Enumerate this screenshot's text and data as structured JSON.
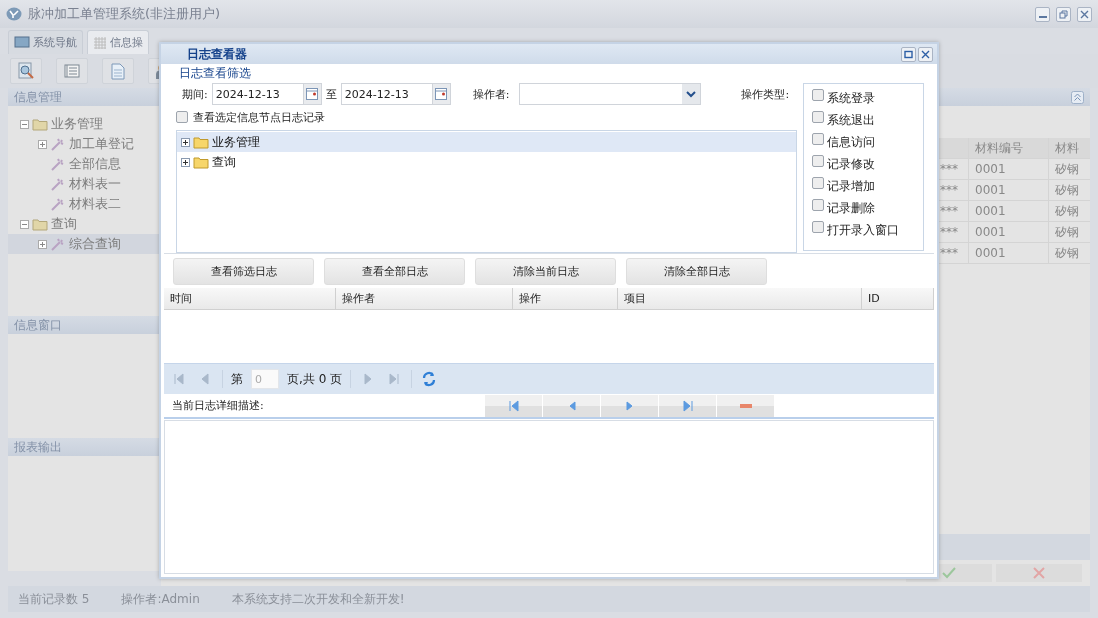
{
  "app": {
    "title": "脉冲加工单管理系统(非注册用户)"
  },
  "tabs": [
    {
      "label": "系统导航",
      "selected": false
    },
    {
      "label": "信息操",
      "selected": true
    }
  ],
  "sidebar": {
    "sections": [
      {
        "title": "信息管理",
        "tree": [
          {
            "label": "业务管理",
            "kind": "folder",
            "expanded": true,
            "selected": false,
            "children": [
              {
                "label": "加工单登记",
                "kind": "tool",
                "expanded": false,
                "selected": false
              },
              {
                "label": "全部信息",
                "kind": "tool",
                "selected": false
              },
              {
                "label": "材料表一",
                "kind": "tool",
                "selected": false
              },
              {
                "label": "材料表二",
                "kind": "tool",
                "selected": false
              }
            ]
          },
          {
            "label": "查询",
            "kind": "folder",
            "expanded": true,
            "selected": false,
            "children": [
              {
                "label": "综合查询",
                "kind": "tool",
                "expanded": false,
                "selected": true
              }
            ]
          }
        ]
      },
      {
        "title": "信息窗口"
      },
      {
        "title": "报表输出"
      }
    ]
  },
  "grid": {
    "columns": [
      "",
      "材料编号",
      "材料"
    ],
    "rows": [
      [
        "***",
        "0001",
        "矽钢"
      ],
      [
        "***",
        "0001",
        "矽钢"
      ],
      [
        "***",
        "0001",
        "矽钢"
      ],
      [
        "***",
        "0001",
        "矽钢"
      ],
      [
        "***",
        "0001",
        "矽钢"
      ]
    ]
  },
  "dialog": {
    "title": "日志查看器",
    "filter": {
      "legend": "日志查看筛选",
      "period_label": "期间:",
      "from": "2024-12-13",
      "to_label": "至",
      "to": "2024-12-13",
      "operator_label": "操作者:",
      "type_label": "操作类型:",
      "types": [
        {
          "label": "系统登录",
          "checked": false
        },
        {
          "label": "系统退出",
          "checked": false
        },
        {
          "label": "信息访问",
          "checked": false
        },
        {
          "label": "记录修改",
          "checked": false
        },
        {
          "label": "记录增加",
          "checked": false
        },
        {
          "label": "记录删除",
          "checked": false
        },
        {
          "label": "打开录入窗口",
          "checked": false
        }
      ],
      "node_filter": {
        "label": "查看选定信息节点日志记录",
        "checked": false
      },
      "tree": [
        {
          "label": "业务管理",
          "expanded": false,
          "selected": true
        },
        {
          "label": "查询",
          "expanded": false,
          "selected": false
        }
      ]
    },
    "buttons": [
      "查看筛选日志",
      "查看全部日志",
      "清除当前日志",
      "清除全部日志"
    ],
    "columns": [
      "时间",
      "操作者",
      "操作",
      "项目",
      "ID"
    ],
    "pager": {
      "page_label": "第",
      "page": "0",
      "total": "页,共 0 页"
    },
    "detail_label": "当前日志详细描述:"
  },
  "status_bar": [
    "当前记录数 5",
    "操作者:Admin",
    "本系统支持二次开发和全新开发!"
  ]
}
